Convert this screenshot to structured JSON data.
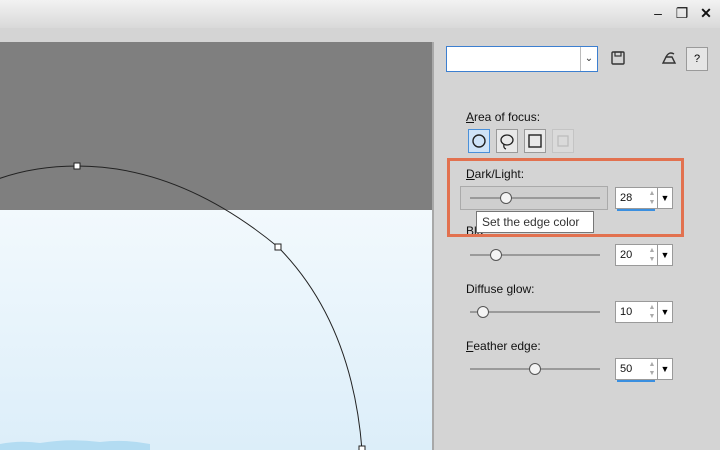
{
  "window": {
    "minimize_label": "–",
    "restore_label": "❐",
    "close_label": "✕"
  },
  "panel": {
    "preset_value": "",
    "help_label": "?",
    "area_of_focus": {
      "label_first": "A",
      "label_rest": "rea of focus:"
    },
    "dark_light": {
      "label_first": "D",
      "label_rest": "ark/Light:",
      "value": "28",
      "level": 28
    },
    "blur": {
      "label_visible": "Blu",
      "value": "20",
      "level": 20
    },
    "diffuse_glow": {
      "label_pre": "Diffuse ",
      "label_ul": "g",
      "label_post": "low:",
      "value": "10",
      "level": 10
    },
    "feather_edge": {
      "label_first": "F",
      "label_rest": "eather edge:",
      "value": "50",
      "level": 50
    }
  },
  "tooltip": {
    "text": "Set the edge color"
  },
  "colors": {
    "highlight": "#e2714f",
    "accent": "#3a8fe0",
    "canvas_dark": "#7f7f7f",
    "canvas_light": "#eef7fc"
  }
}
